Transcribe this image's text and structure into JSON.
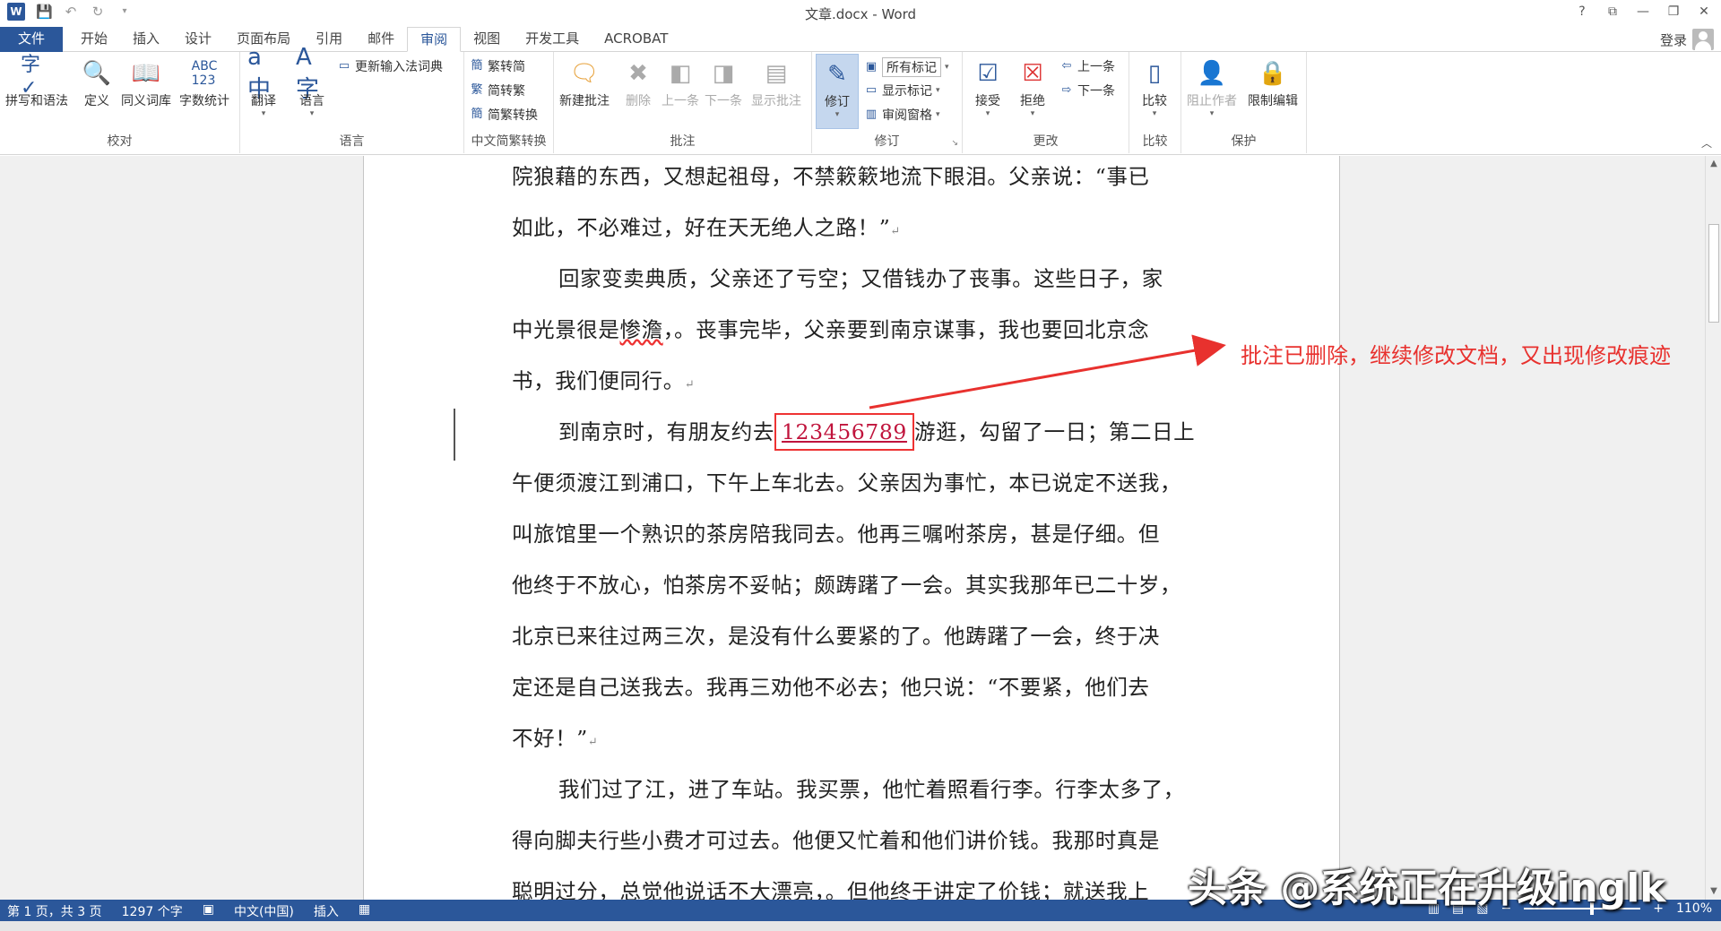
{
  "window": {
    "title": "文章.docx - Word",
    "help": "?",
    "controls": [
      "⧉",
      "—",
      "❐",
      "✕"
    ]
  },
  "tabs": [
    "文件",
    "开始",
    "插入",
    "设计",
    "页面布局",
    "引用",
    "邮件",
    "审阅",
    "视图",
    "开发工具",
    "ACROBAT"
  ],
  "active_tab": "审阅",
  "account": {
    "login": "登录"
  },
  "ribbon": {
    "proofing": {
      "label": "校对",
      "spelling": "拼写和语法",
      "define": "定义",
      "thesaurus": "同义词库",
      "wordcount": "字数统计"
    },
    "language": {
      "label": "语言",
      "translate": "翻译",
      "language": "语言",
      "update_ime": "更新输入法词典"
    },
    "chinese": {
      "label": "中文简繁转换",
      "t2s": "繁转简",
      "s2t": "简转繁",
      "convert": "简繁转换"
    },
    "comments": {
      "label": "批注",
      "new": "新建批注",
      "delete": "删除",
      "prev": "上一条",
      "next": "下一条",
      "show": "显示批注"
    },
    "tracking": {
      "label": "修订",
      "track": "修订",
      "markup_select": "所有标记",
      "show_markup": "显示标记",
      "review_pane": "审阅窗格"
    },
    "changes": {
      "label": "更改",
      "accept": "接受",
      "reject": "拒绝",
      "prev": "上一条",
      "next": "下一条"
    },
    "compare": {
      "label": "比较",
      "compare": "比较"
    },
    "protect": {
      "label": "保护",
      "block_authors": "阻止作者",
      "restrict": "限制编辑"
    }
  },
  "document": {
    "lines": [
      {
        "text": "院狼藉的东西，又想起祖母，不禁簌簌地流下眼泪。父亲说：“事已",
        "indent": false
      },
      {
        "text": "如此，不必难过，好在天无绝人之路！”",
        "indent": false,
        "mark": "↵"
      },
      {
        "text": "回家变卖典质，父亲还了亏空；又借钱办了丧事。这些日子，家",
        "indent": true
      },
      {
        "pre": "中光景很是",
        "squiggle": "惨澹",
        "post": "，。丧事完毕，父亲要到南京谋事，我也要回北京念",
        "indent": false
      },
      {
        "text": "书，我们便同行。",
        "indent": false,
        "mark": "↵"
      },
      {
        "pre": "到南京时，有朋友约去",
        "inserted": "123456789",
        "post": "游逛，勾留了一日；第二日上",
        "indent": true
      },
      {
        "text": "午便须渡江到浦口，下午上车北去。父亲因为事忙，本已说定不送我，",
        "indent": false
      },
      {
        "text": "叫旅馆里一个熟识的茶房陪我同去。他再三嘱咐茶房，甚是仔细。但",
        "indent": false
      },
      {
        "text": "他终于不放心，怕茶房不妥帖；颇踌躇了一会。其实我那年已二十岁，",
        "indent": false
      },
      {
        "text": "北京已来往过两三次，是没有什么要紧的了。他踌躇了一会，终于决",
        "indent": false
      },
      {
        "text": "定还是自己送我去。我再三劝他不必去；他只说：“不要紧，他们去",
        "indent": false
      },
      {
        "text": "不好！”",
        "indent": false,
        "mark": "↵"
      },
      {
        "text": "我们过了江，进了车站。我买票，他忙着照看行李。行李太多了，",
        "indent": true
      },
      {
        "text": "得向脚夫行些小费才可过去。他便又忙着和他们讲价钱。我那时真是",
        "indent": false
      },
      {
        "text": "聪明过分，总觉他说话不大漂亮，。但他终于讲定了价钱；就送我上",
        "indent": false
      }
    ]
  },
  "annotation": {
    "text": "批注已删除，继续修改文档，又出现修改痕迹"
  },
  "status": {
    "page": "第 1 页，共 3 页",
    "words": "1297 个字",
    "lang": "中文(中国)",
    "mode": "插入",
    "zoom": "110%"
  },
  "watermark": "头条 @系统正在升级inglk",
  "colors": {
    "accent": "#2b579a",
    "revision": "#c0143c",
    "annotation": "#e8312e"
  }
}
